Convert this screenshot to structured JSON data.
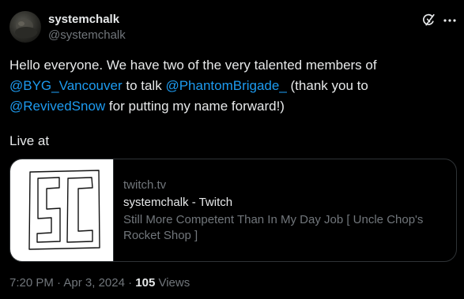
{
  "author": {
    "display_name": "systemchalk",
    "handle": "@systemchalk"
  },
  "icons": {
    "avatar": "user-avatar",
    "grok": "grok-icon",
    "more": "more-icon"
  },
  "tweet": {
    "line1": "Hello everyone. We have two of the very talented members of",
    "mention1": "@BYG_Vancouver",
    "text2": " to talk ",
    "mention2": "@PhantomBrigade_",
    "text3": " (thank you to",
    "mention3": "@RevivedSnow",
    "text4": " for putting my name forward!)",
    "live": "Live at"
  },
  "card": {
    "domain": "twitch.tv",
    "title": "systemchalk - Twitch",
    "description_line1": "Still More Competent Than In My Day Job [ Uncle Chop's",
    "description_line2": "Rocket Shop ]"
  },
  "meta": {
    "time": "7:20 PM",
    "sep1": " · ",
    "date": "Apr 3, 2024",
    "sep2": " · ",
    "views_count": "105",
    "views_label": " Views"
  },
  "colors": {
    "background": "#000000",
    "text": "#e7e9ea",
    "secondary": "#71767b",
    "link": "#1d9bf0",
    "border": "#2f3336"
  }
}
